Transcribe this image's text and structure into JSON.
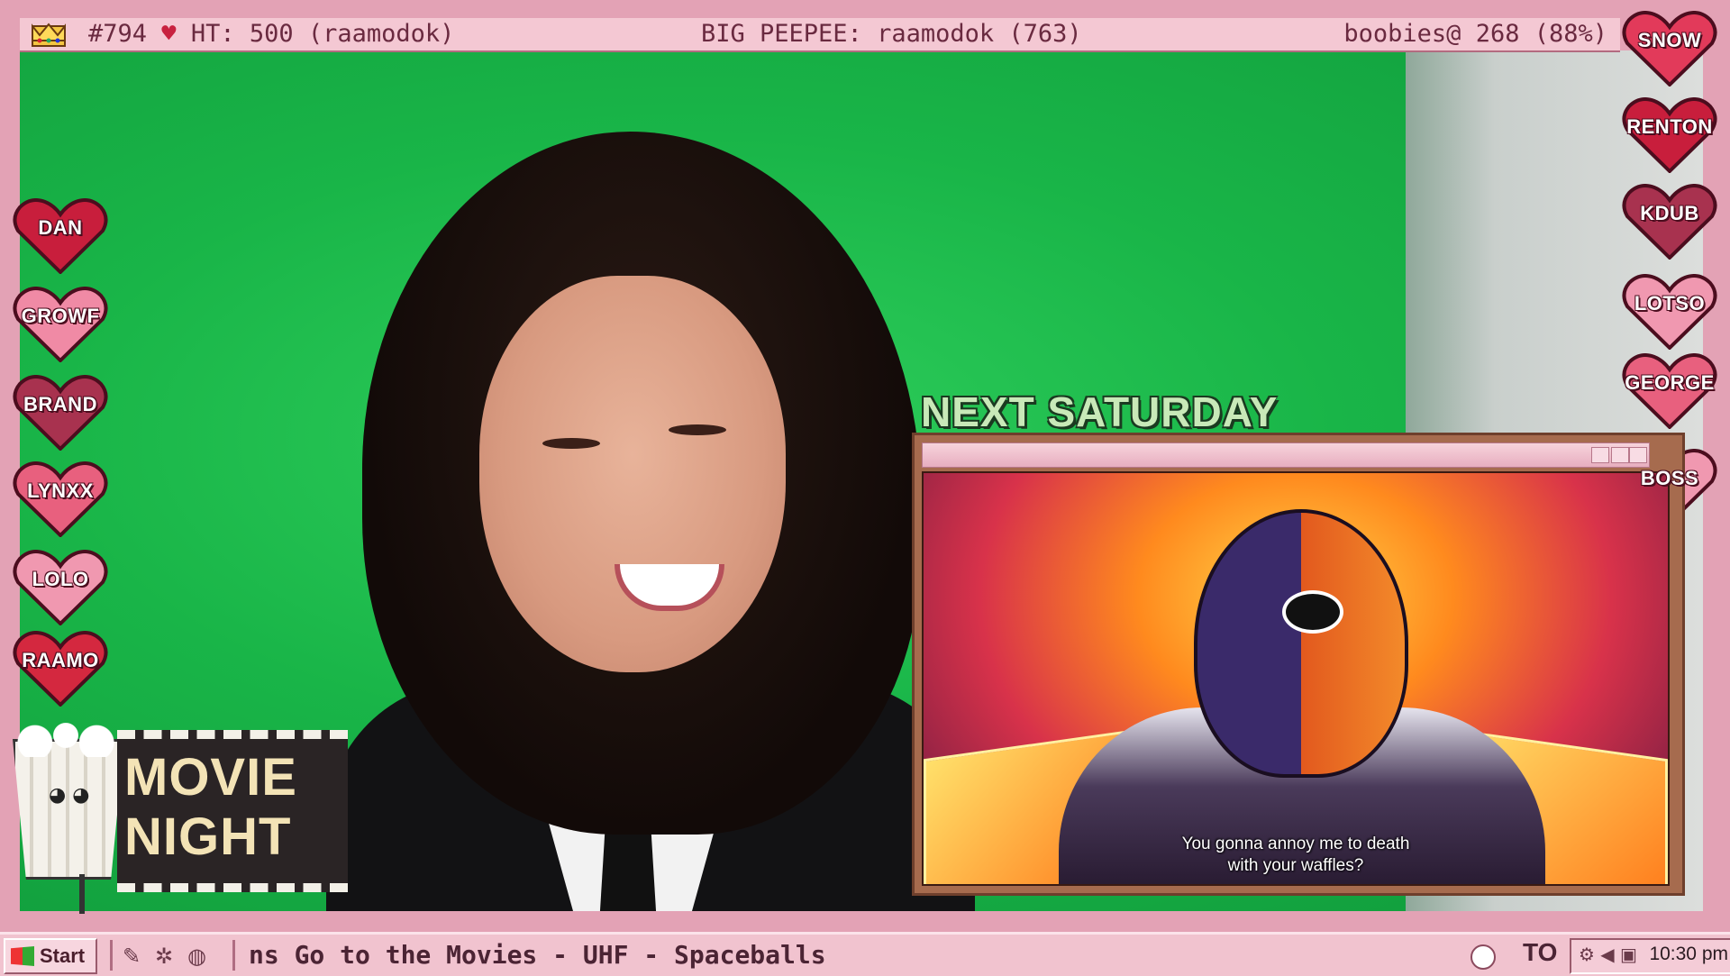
{
  "topbar": {
    "left": "#794 ♥ HT: 500 (raamodok)",
    "left_prefix": "#794",
    "left_suffix": "HT: 500 (raamodok)",
    "center": "BIG PEEPEE: raamodok (763)",
    "right": "boobies@ 268 (88%)"
  },
  "hearts_left": [
    {
      "label": "DAN",
      "color": "#c81e3c"
    },
    {
      "label": "GROWF",
      "color": "#f08aa5"
    },
    {
      "label": "BRAND",
      "color": "#a8324f"
    },
    {
      "label": "LYNXX",
      "color": "#e8607e"
    },
    {
      "label": "LOLO",
      "color": "#f098b0"
    },
    {
      "label": "RAAMO",
      "color": "#d4283f"
    }
  ],
  "hearts_right": [
    {
      "label": "SNOW",
      "color": "#e23a5a"
    },
    {
      "label": "RENTON",
      "color": "#c81e3c"
    },
    {
      "label": "KDUB",
      "color": "#a8324f"
    },
    {
      "label": "LOTSO",
      "color": "#f098b0"
    },
    {
      "label": "GEORGE",
      "color": "#e8607e"
    },
    {
      "label": "BOSS",
      "color": "#f098b0"
    }
  ],
  "next_saturday": "NEXT SATURDAY",
  "movie": {
    "subtitle_line1": "You gonna annoy me to death",
    "subtitle_line2": "with your waffles?"
  },
  "logo": {
    "line1": "MOVIE",
    "line2": "NIGHT"
  },
  "taskbar": {
    "start_label": "Start",
    "marquee": "ns Go to the Movies - UHF - Spaceballs",
    "tray_text": "TO",
    "clock": "10:30 pm"
  },
  "colors": {
    "frame": "#e3a2b5",
    "greenscreen": "#19b548",
    "taskbar": "#f1c3cf"
  }
}
